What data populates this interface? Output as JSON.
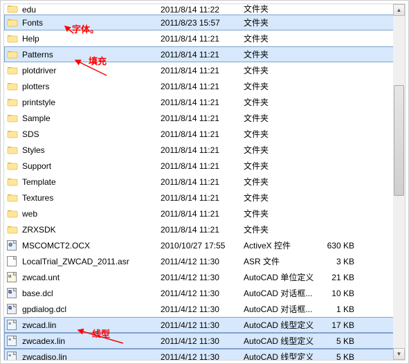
{
  "annotations": {
    "fonts": "字体。",
    "patterns": "填充",
    "lin": "线型"
  },
  "rows": [
    {
      "icon": "folder",
      "name": "edu",
      "date": "2011/8/14 11:22",
      "type": "文件夹",
      "size": "",
      "sel": false
    },
    {
      "icon": "folder",
      "name": "Fonts",
      "date": "2011/8/23 15:57",
      "type": "文件夹",
      "size": "",
      "sel": true
    },
    {
      "icon": "folder",
      "name": "Help",
      "date": "2011/8/14 11:21",
      "type": "文件夹",
      "size": "",
      "sel": false
    },
    {
      "icon": "folder",
      "name": "Patterns",
      "date": "2011/8/14 11:21",
      "type": "文件夹",
      "size": "",
      "sel": true
    },
    {
      "icon": "folder",
      "name": "plotdriver",
      "date": "2011/8/14 11:21",
      "type": "文件夹",
      "size": "",
      "sel": false
    },
    {
      "icon": "folder",
      "name": "plotters",
      "date": "2011/8/14 11:21",
      "type": "文件夹",
      "size": "",
      "sel": false
    },
    {
      "icon": "folder",
      "name": "printstyle",
      "date": "2011/8/14 11:21",
      "type": "文件夹",
      "size": "",
      "sel": false
    },
    {
      "icon": "folder",
      "name": "Sample",
      "date": "2011/8/14 11:21",
      "type": "文件夹",
      "size": "",
      "sel": false
    },
    {
      "icon": "folder",
      "name": "SDS",
      "date": "2011/8/14 11:21",
      "type": "文件夹",
      "size": "",
      "sel": false
    },
    {
      "icon": "folder",
      "name": "Styles",
      "date": "2011/8/14 11:21",
      "type": "文件夹",
      "size": "",
      "sel": false
    },
    {
      "icon": "folder",
      "name": "Support",
      "date": "2011/8/14 11:21",
      "type": "文件夹",
      "size": "",
      "sel": false
    },
    {
      "icon": "folder",
      "name": "Template",
      "date": "2011/8/14 11:21",
      "type": "文件夹",
      "size": "",
      "sel": false
    },
    {
      "icon": "folder",
      "name": "Textures",
      "date": "2011/8/14 11:21",
      "type": "文件夹",
      "size": "",
      "sel": false
    },
    {
      "icon": "folder",
      "name": "web",
      "date": "2011/8/14 11:21",
      "type": "文件夹",
      "size": "",
      "sel": false
    },
    {
      "icon": "folder",
      "name": "ZRXSDK",
      "date": "2011/8/14 11:21",
      "type": "文件夹",
      "size": "",
      "sel": false
    },
    {
      "icon": "ocx",
      "name": "MSCOMCT2.OCX",
      "date": "2010/10/27 17:55",
      "type": "ActiveX 控件",
      "size": "630 KB",
      "sel": false
    },
    {
      "icon": "asr",
      "name": "LocalTrial_ZWCAD_2011.asr",
      "date": "2011/4/12 11:30",
      "type": "ASR 文件",
      "size": "3 KB",
      "sel": false
    },
    {
      "icon": "unt",
      "name": "zwcad.unt",
      "date": "2011/4/12 11:30",
      "type": "AutoCAD 单位定义",
      "size": "21 KB",
      "sel": false
    },
    {
      "icon": "dcl",
      "name": "base.dcl",
      "date": "2011/4/12 11:30",
      "type": "AutoCAD 对话框...",
      "size": "10 KB",
      "sel": false
    },
    {
      "icon": "dcl",
      "name": "gpdialog.dcl",
      "date": "2011/4/12 11:30",
      "type": "AutoCAD 对话框...",
      "size": "1 KB",
      "sel": false
    },
    {
      "icon": "lin",
      "name": "zwcad.lin",
      "date": "2011/4/12 11:30",
      "type": "AutoCAD 线型定义",
      "size": "17 KB",
      "sel": true
    },
    {
      "icon": "lin",
      "name": "zwcadex.lin",
      "date": "2011/4/12 11:30",
      "type": "AutoCAD 线型定义",
      "size": "5 KB",
      "sel": true
    },
    {
      "icon": "lin",
      "name": "zwcadiso.lin",
      "date": "2011/4/12 11:30",
      "type": "AutoCAD 线型定义",
      "size": "5 KB",
      "sel": true
    }
  ]
}
